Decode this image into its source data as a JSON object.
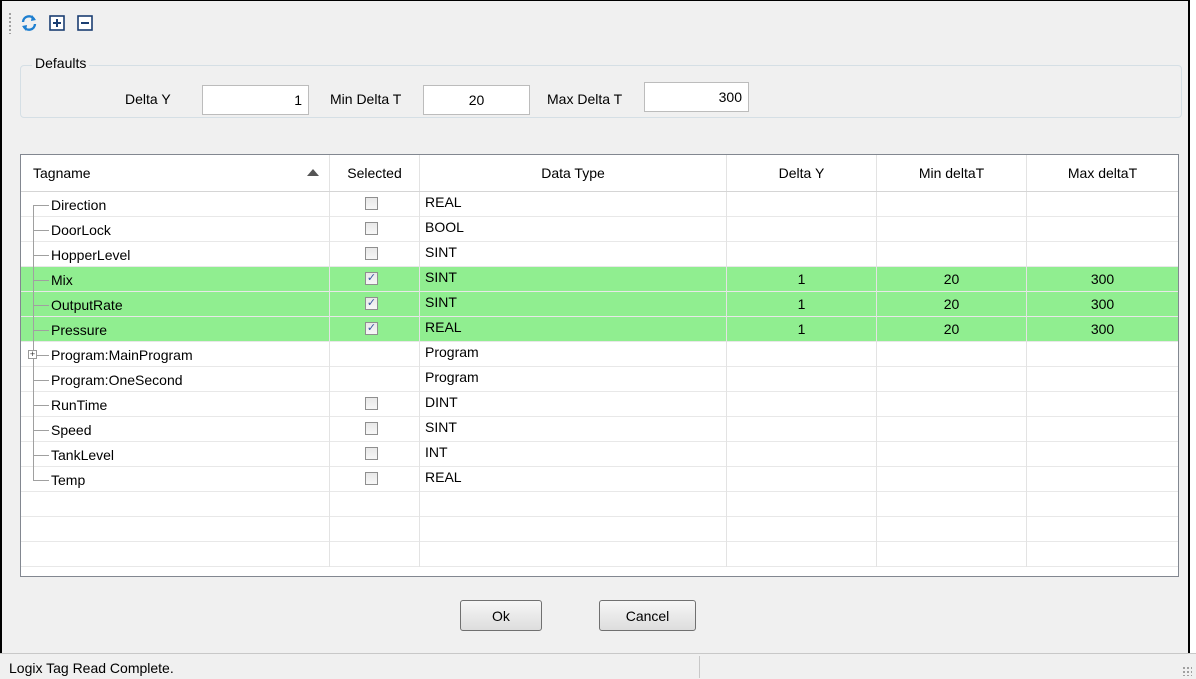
{
  "toolbar": {
    "buttons": [
      {
        "icon": "refresh-icon"
      },
      {
        "icon": "expand-all-icon"
      },
      {
        "icon": "collapse-all-icon"
      }
    ]
  },
  "defaults": {
    "legend": "Defaults",
    "delta_y_label": "Delta Y",
    "delta_y_value": "1",
    "min_delta_t_label": "Min Delta T",
    "min_delta_t_value": "20",
    "max_delta_t_label": "Max Delta T",
    "max_delta_t_value": "300"
  },
  "grid": {
    "columns": [
      "Tagname",
      "Selected",
      "Data Type",
      "Delta Y",
      "Min deltaT",
      "Max deltaT"
    ],
    "rows": [
      {
        "tag": "Direction",
        "checkbox": true,
        "checked": false,
        "type": "REAL",
        "dy": "",
        "min": "",
        "max": "",
        "highlight": false
      },
      {
        "tag": "DoorLock",
        "checkbox": true,
        "checked": false,
        "type": "BOOL",
        "dy": "",
        "min": "",
        "max": "",
        "highlight": false
      },
      {
        "tag": "HopperLevel",
        "checkbox": true,
        "checked": false,
        "type": "SINT",
        "dy": "",
        "min": "",
        "max": "",
        "highlight": false
      },
      {
        "tag": "Mix",
        "checkbox": true,
        "checked": true,
        "type": "SINT",
        "dy": "1",
        "min": "20",
        "max": "300",
        "highlight": true
      },
      {
        "tag": "OutputRate",
        "checkbox": true,
        "checked": true,
        "type": "SINT",
        "dy": "1",
        "min": "20",
        "max": "300",
        "highlight": true
      },
      {
        "tag": "Pressure",
        "checkbox": true,
        "checked": true,
        "type": "REAL",
        "dy": "1",
        "min": "20",
        "max": "300",
        "highlight": true
      },
      {
        "tag": "Program:MainProgram",
        "checkbox": false,
        "checked": false,
        "type": "Program",
        "dy": "",
        "min": "",
        "max": "",
        "highlight": false,
        "expandable": true
      },
      {
        "tag": "Program:OneSecond",
        "checkbox": false,
        "checked": false,
        "type": "Program",
        "dy": "",
        "min": "",
        "max": "",
        "highlight": false
      },
      {
        "tag": "RunTime",
        "checkbox": true,
        "checked": false,
        "type": "DINT",
        "dy": "",
        "min": "",
        "max": "",
        "highlight": false
      },
      {
        "tag": "Speed",
        "checkbox": true,
        "checked": false,
        "type": "SINT",
        "dy": "",
        "min": "",
        "max": "",
        "highlight": false
      },
      {
        "tag": "TankLevel",
        "checkbox": true,
        "checked": false,
        "type": "INT",
        "dy": "",
        "min": "",
        "max": "",
        "highlight": false
      },
      {
        "tag": "Temp",
        "checkbox": true,
        "checked": false,
        "type": "REAL",
        "dy": "",
        "min": "",
        "max": "",
        "highlight": false,
        "last": true
      }
    ],
    "empty_rows": 3
  },
  "buttons": {
    "ok": "Ok",
    "cancel": "Cancel"
  },
  "status": {
    "text": "Logix Tag Read Complete."
  },
  "colors": {
    "selected_row": "#90ee90",
    "accent_icon": "#1e7fd0"
  }
}
